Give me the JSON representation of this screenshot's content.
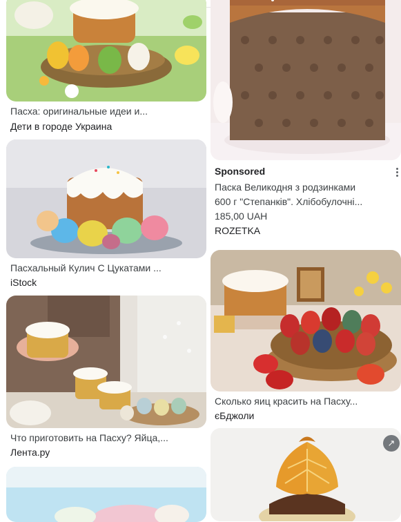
{
  "results": {
    "left": [
      {
        "title": "Пасха: оригинальные идеи и...",
        "source": "Дети в городе Украина",
        "image": "easter-basket-kulich"
      },
      {
        "title": "Пасхальный Кулич С Цукатами ...",
        "source": "iStock",
        "image": "kulich-with-eggs"
      },
      {
        "title": "Что приготовить на Пасху? Яйца,...",
        "source": "Лента.ру",
        "image": "woman-holding-kulich"
      },
      {
        "title": "",
        "source": "",
        "image": "kulich-partial"
      }
    ],
    "right": [
      {
        "image": "large-paska-close-up"
      },
      {
        "sponsored_label": "Sponsored",
        "line1": "Паска Великодня з родзинками",
        "line2": "600 г \"Степанків\". Хлібобулочні...",
        "price": "185,00 UAH",
        "store": "ROZETKA",
        "more_icon": "more-vert-icon"
      },
      {
        "title": "Сколько яиц красить на Пасху...",
        "source": "єБджоли",
        "image": "pysanky-basket"
      },
      {
        "image": "orange-slice-cake",
        "badge_icon": "open-external-icon"
      }
    ]
  },
  "colors": {
    "text": "#202124",
    "muted": "#3c4043",
    "badge": "#5f6368"
  }
}
